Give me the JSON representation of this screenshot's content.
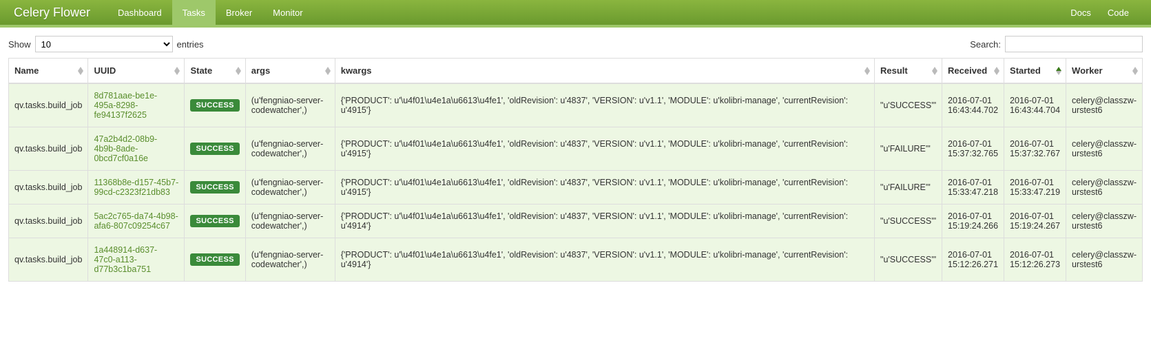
{
  "navbar": {
    "brand": "Celery Flower",
    "items": [
      "Dashboard",
      "Tasks",
      "Broker",
      "Monitor"
    ],
    "active_index": 1,
    "right_items": [
      "Docs",
      "Code"
    ]
  },
  "controls": {
    "show_label_prefix": "Show",
    "show_label_suffix": "entries",
    "show_value": "10",
    "search_label": "Search:",
    "search_value": ""
  },
  "table": {
    "columns": [
      "Name",
      "UUID",
      "State",
      "args",
      "kwargs",
      "Result",
      "Received",
      "Started",
      "Worker"
    ],
    "sorted_column_index": 7,
    "sorted_dir": "asc",
    "rows": [
      {
        "name": "qv.tasks.build_job",
        "uuid": "8d781aae-be1e-495a-8298-fe94137f2625",
        "state": "SUCCESS",
        "args": "(u'fengniao-server-codewatcher',)",
        "kwargs": "{'PRODUCT': u'\\u4f01\\u4e1a\\u6613\\u4fe1', 'oldRevision': u'4837', 'VERSION': u'v1.1', 'MODULE': u'kolibri-manage', 'currentRevision': u'4915'}",
        "result": "\"u'SUCCESS'\"",
        "received": "2016-07-01 16:43:44.702",
        "started": "2016-07-01 16:43:44.704",
        "worker": "celery@classzw-urstest6"
      },
      {
        "name": "qv.tasks.build_job",
        "uuid": "47a2b4d2-08b9-4b9b-8ade-0bcd7cf0a16e",
        "state": "SUCCESS",
        "args": "(u'fengniao-server-codewatcher',)",
        "kwargs": "{'PRODUCT': u'\\u4f01\\u4e1a\\u6613\\u4fe1', 'oldRevision': u'4837', 'VERSION': u'v1.1', 'MODULE': u'kolibri-manage', 'currentRevision': u'4915'}",
        "result": "\"u'FAILURE'\"",
        "received": "2016-07-01 15:37:32.765",
        "started": "2016-07-01 15:37:32.767",
        "worker": "celery@classzw-urstest6"
      },
      {
        "name": "qv.tasks.build_job",
        "uuid": "11368b8e-d157-45b7-99cd-c2323f21db83",
        "state": "SUCCESS",
        "args": "(u'fengniao-server-codewatcher',)",
        "kwargs": "{'PRODUCT': u'\\u4f01\\u4e1a\\u6613\\u4fe1', 'oldRevision': u'4837', 'VERSION': u'v1.1', 'MODULE': u'kolibri-manage', 'currentRevision': u'4915'}",
        "result": "\"u'FAILURE'\"",
        "received": "2016-07-01 15:33:47.218",
        "started": "2016-07-01 15:33:47.219",
        "worker": "celery@classzw-urstest6"
      },
      {
        "name": "qv.tasks.build_job",
        "uuid": "5ac2c765-da74-4b98-afa6-807c09254c67",
        "state": "SUCCESS",
        "args": "(u'fengniao-server-codewatcher',)",
        "kwargs": "{'PRODUCT': u'\\u4f01\\u4e1a\\u6613\\u4fe1', 'oldRevision': u'4837', 'VERSION': u'v1.1', 'MODULE': u'kolibri-manage', 'currentRevision': u'4914'}",
        "result": "\"u'SUCCESS'\"",
        "received": "2016-07-01 15:19:24.266",
        "started": "2016-07-01 15:19:24.267",
        "worker": "celery@classzw-urstest6"
      },
      {
        "name": "qv.tasks.build_job",
        "uuid": "1a448914-d637-47c0-a113-d77b3c1ba751",
        "state": "SUCCESS",
        "args": "(u'fengniao-server-codewatcher',)",
        "kwargs": "{'PRODUCT': u'\\u4f01\\u4e1a\\u6613\\u4fe1', 'oldRevision': u'4837', 'VERSION': u'v1.1', 'MODULE': u'kolibri-manage', 'currentRevision': u'4914'}",
        "result": "\"u'SUCCESS'\"",
        "received": "2016-07-01 15:12:26.271",
        "started": "2016-07-01 15:12:26.273",
        "worker": "celery@classzw-urstest6"
      }
    ]
  }
}
